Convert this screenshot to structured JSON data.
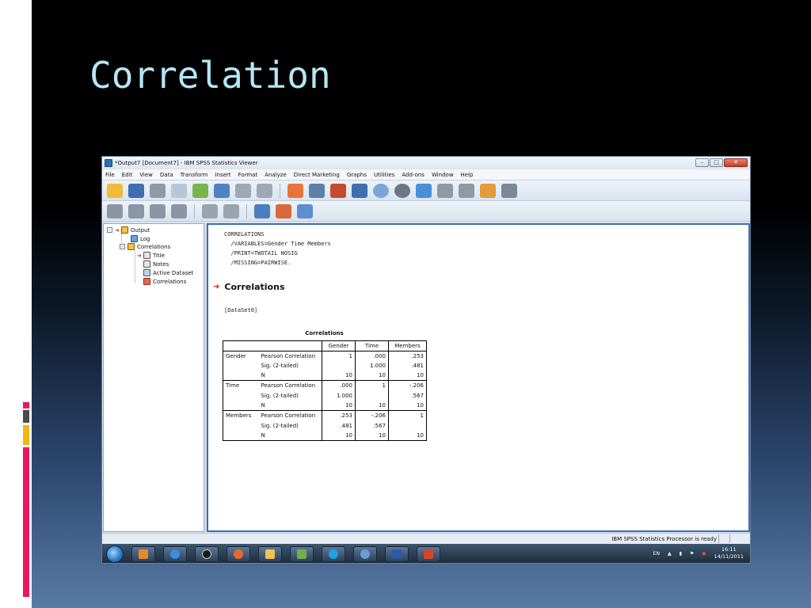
{
  "slide": {
    "title": "Correlation"
  },
  "colors": {
    "accent_pink": "#e6195c",
    "accent_gray": "#4a4a4a",
    "accent_yellow": "#f3b416",
    "title_color": "#b6e6f4",
    "viewer_border": "#3b6db5"
  },
  "window": {
    "title": "*Output7 [Document7] - IBM SPSS Statistics Viewer",
    "controls": [
      "minimize",
      "maximize",
      "close"
    ]
  },
  "menu": [
    "File",
    "Edit",
    "View",
    "Data",
    "Transform",
    "Insert",
    "Format",
    "Analyze",
    "Direct Marketing",
    "Graphs",
    "Utilities",
    "Add-ons",
    "Window",
    "Help"
  ],
  "toolbar1_icons": [
    "open-icon",
    "save-icon",
    "print-icon",
    "print-preview-icon",
    "export-icon",
    "recall-dialog-icon",
    "undo-icon",
    "redo-icon",
    "goto-case-icon",
    "goto-variable-icon",
    "insert-cases-icon",
    "variables-icon",
    "show-output-icon",
    "hide-output-icon",
    "designate-window-icon",
    "insert-heading-icon",
    "insert-title-icon",
    "insert-text-icon",
    "run-script-icon"
  ],
  "toolbar2_icons": [
    "back-icon",
    "forward-icon",
    "expand-icon",
    "collapse-icon",
    "show-icon",
    "hide-icon",
    "insert-heading-icon",
    "insert-chart-icon",
    "insert-text-icon"
  ],
  "outline": {
    "root": "Output",
    "log": "Log",
    "correlations": "Correlations",
    "children": [
      "Title",
      "Notes",
      "Active Dataset",
      "Correlations"
    ]
  },
  "viewer": {
    "syntax": [
      "CORRELATIONS",
      "  /VARIABLES=Gender Time Members",
      "  /PRINT=TWOTAIL NOSIG",
      "  /MISSING=PAIRWISE."
    ],
    "heading": "Correlations",
    "dataset": "[DataSet0]",
    "table": {
      "caption": "Correlations",
      "columns": [
        "Gender",
        "Time",
        "Members"
      ],
      "groups": [
        {
          "name": "Gender",
          "rows": [
            {
              "label": "Pearson Correlation",
              "values": [
                "1",
                ".000",
                ".253"
              ]
            },
            {
              "label": "Sig. (2-tailed)",
              "values": [
                "",
                "1.000",
                ".481"
              ]
            },
            {
              "label": "N",
              "values": [
                "10",
                "10",
                "10"
              ]
            }
          ]
        },
        {
          "name": "Time",
          "rows": [
            {
              "label": "Pearson Correlation",
              "values": [
                ".000",
                "1",
                "-.206"
              ]
            },
            {
              "label": "Sig. (2-tailed)",
              "values": [
                "1.000",
                "",
                ".567"
              ]
            },
            {
              "label": "N",
              "values": [
                "10",
                "10",
                "10"
              ]
            }
          ]
        },
        {
          "name": "Members",
          "rows": [
            {
              "label": "Pearson Correlation",
              "values": [
                ".253",
                "-.206",
                "1"
              ]
            },
            {
              "label": "Sig. (2-tailed)",
              "values": [
                ".481",
                ".567",
                ""
              ]
            },
            {
              "label": "N",
              "values": [
                "10",
                "10",
                "10"
              ]
            }
          ]
        }
      ]
    }
  },
  "status": {
    "text": "IBM SPSS Statistics Processor is ready"
  },
  "taskbar": {
    "apps": [
      "media-player-icon",
      "internet-explorer-icon",
      "hp-icon",
      "firefox-icon",
      "file-explorer-icon",
      "network-icon",
      "skype-icon",
      "spss-icon",
      "word-icon",
      "powerpoint-icon"
    ],
    "tray": {
      "language": "EN",
      "time": "16:11",
      "date": "14/11/2011"
    }
  }
}
